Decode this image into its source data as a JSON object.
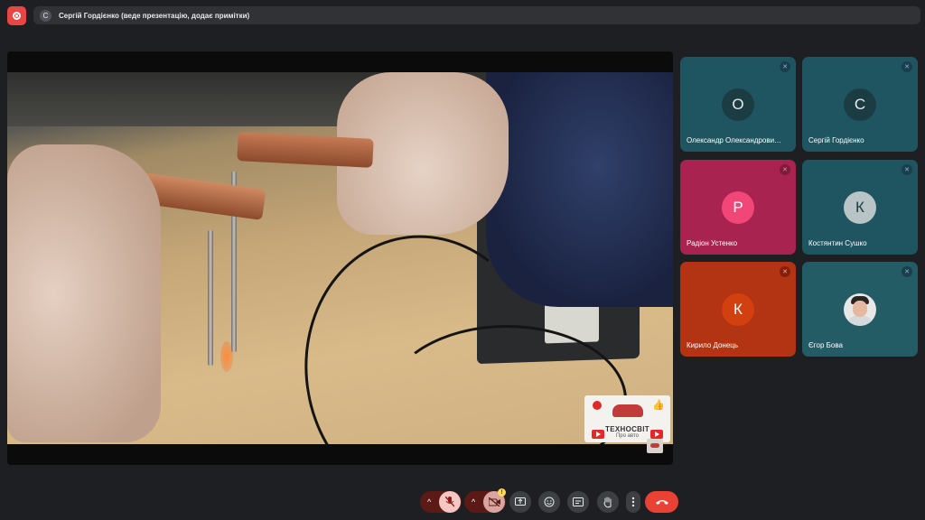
{
  "header": {
    "presenter_initial": "С",
    "presenter_text": "Сергій Гордієнко (веде презентацію, додає примітки)"
  },
  "presentation": {
    "watermark_title": "ТЕХНОСВІТ",
    "watermark_subtitle": "Про авто"
  },
  "participants": [
    {
      "initial": "О",
      "name": "Олександр Олександрови…",
      "mic": "muted"
    },
    {
      "initial": "С",
      "name": "Сергій Гордієнко",
      "mic": "muted"
    },
    {
      "initial": "Р",
      "name": "Радіон Устенко",
      "mic": "muted"
    },
    {
      "initial": "К",
      "name": "Костянтин Сушко",
      "mic": "muted"
    },
    {
      "initial": "К",
      "name": "Кирило Донець",
      "mic": "muted"
    },
    {
      "initial": "",
      "name": "Єгор Бова",
      "mic": "muted"
    }
  ],
  "toolbar": {
    "camera_badge": "!",
    "icons": [
      "chevron-up-icon",
      "mic-off-icon",
      "chevron-up-icon",
      "camera-off-icon",
      "present-screen-icon",
      "emoji-icon",
      "captions-icon",
      "raise-hand-icon",
      "more-vert-icon",
      "end-call-icon"
    ]
  },
  "colors": {
    "record": "#e84545",
    "tile_teal": "#1f5560",
    "tile_pink": "#a8234f",
    "tile_orange": "#b23412",
    "end_call": "#e94235",
    "mic_off": "#f5c6c2"
  }
}
